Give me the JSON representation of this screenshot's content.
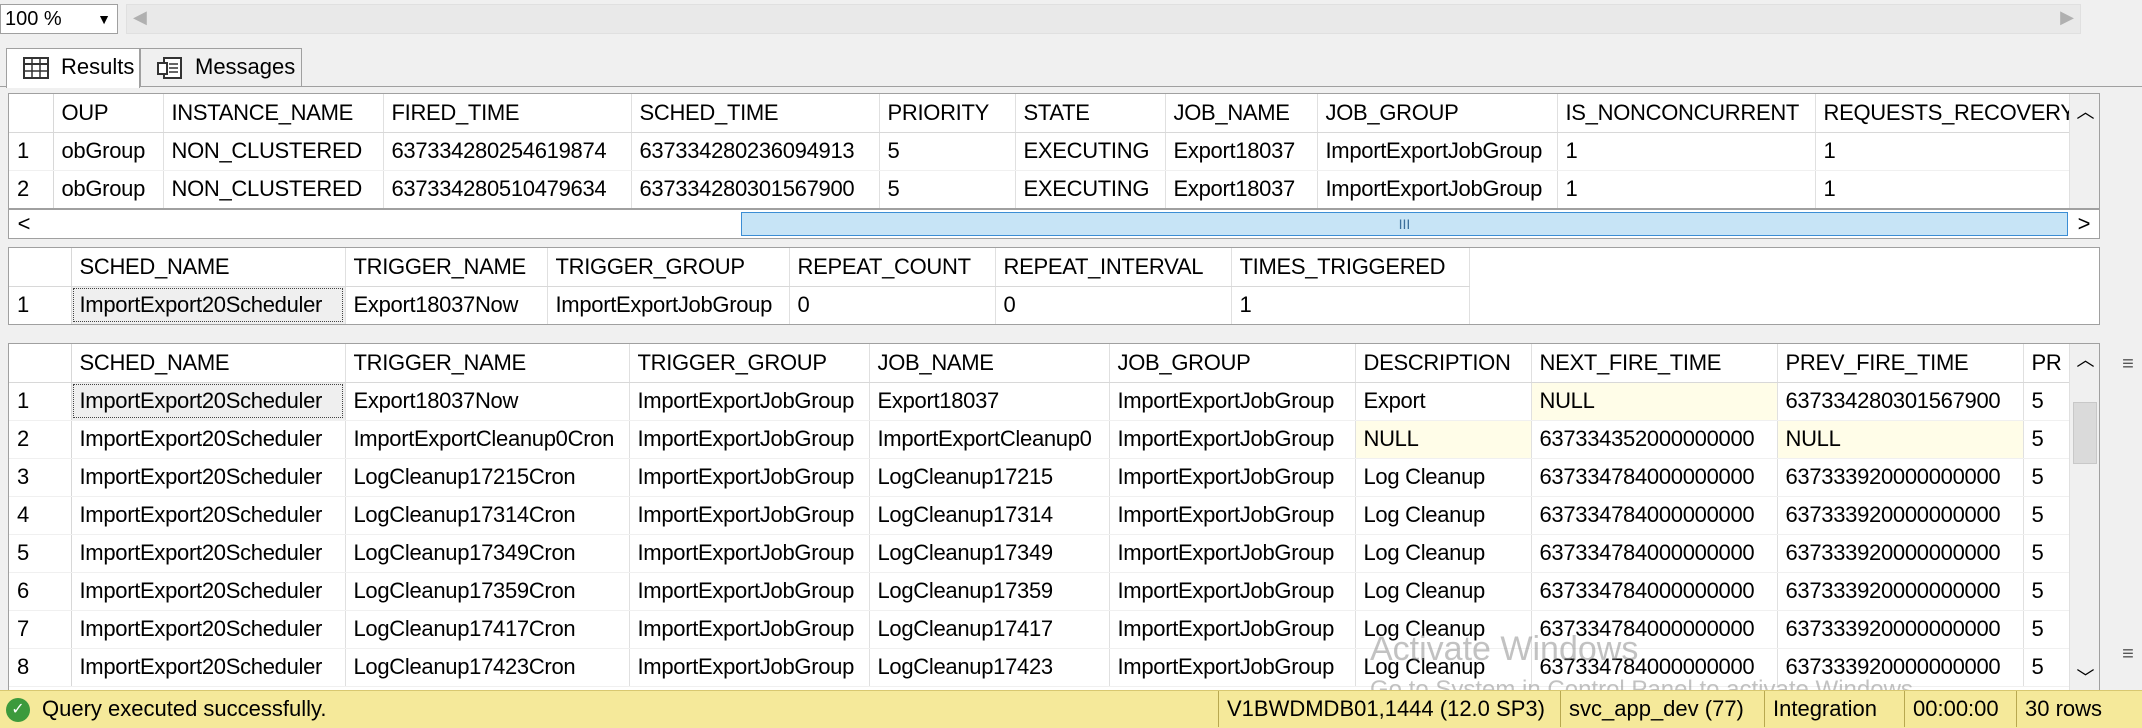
{
  "zoom": {
    "value": "100 %"
  },
  "tabs": [
    {
      "label": "Results",
      "icon": "grid-icon",
      "active": true
    },
    {
      "label": "Messages",
      "icon": "messages-icon",
      "active": false
    }
  ],
  "grid1": {
    "headers": [
      "",
      "OUP",
      "INSTANCE_NAME",
      "FIRED_TIME",
      "SCHED_TIME",
      "PRIORITY",
      "STATE",
      "JOB_NAME",
      "JOB_GROUP",
      "IS_NONCONCURRENT",
      "REQUESTS_RECOVERY"
    ],
    "rows": [
      [
        "1",
        "obGroup",
        "NON_CLUSTERED",
        "637334280254619874",
        "637334280236094913",
        "5",
        "EXECUTING",
        "Export18037",
        "ImportExportJobGroup",
        "1",
        "1"
      ],
      [
        "2",
        "obGroup",
        "NON_CLUSTERED",
        "637334280510479634",
        "637334280301567900",
        "5",
        "EXECUTING",
        "Export18037",
        "ImportExportJobGroup",
        "1",
        "1"
      ]
    ]
  },
  "grid2": {
    "headers": [
      "",
      "SCHED_NAME",
      "TRIGGER_NAME",
      "TRIGGER_GROUP",
      "REPEAT_COUNT",
      "REPEAT_INTERVAL",
      "TIMES_TRIGGERED"
    ],
    "rows": [
      [
        "1",
        "ImportExport20Scheduler",
        "Export18037Now",
        "ImportExportJobGroup",
        "0",
        "0",
        "1"
      ]
    ]
  },
  "grid3": {
    "headers": [
      "",
      "SCHED_NAME",
      "TRIGGER_NAME",
      "TRIGGER_GROUP",
      "JOB_NAME",
      "JOB_GROUP",
      "DESCRIPTION",
      "NEXT_FIRE_TIME",
      "PREV_FIRE_TIME",
      "PR"
    ],
    "rows": [
      [
        "1",
        "ImportExport20Scheduler",
        "Export18037Now",
        "ImportExportJobGroup",
        "Export18037",
        "ImportExportJobGroup",
        "Export",
        "NULL",
        "637334280301567900",
        "5"
      ],
      [
        "2",
        "ImportExport20Scheduler",
        "ImportExportCleanup0Cron",
        "ImportExportJobGroup",
        "ImportExportCleanup0",
        "ImportExportJobGroup",
        "NULL",
        "637334352000000000",
        "NULL",
        "5"
      ],
      [
        "3",
        "ImportExport20Scheduler",
        "LogCleanup17215Cron",
        "ImportExportJobGroup",
        "LogCleanup17215",
        "ImportExportJobGroup",
        "Log Cleanup",
        "637334784000000000",
        "637333920000000000",
        "5"
      ],
      [
        "4",
        "ImportExport20Scheduler",
        "LogCleanup17314Cron",
        "ImportExportJobGroup",
        "LogCleanup17314",
        "ImportExportJobGroup",
        "Log Cleanup",
        "637334784000000000",
        "637333920000000000",
        "5"
      ],
      [
        "5",
        "ImportExport20Scheduler",
        "LogCleanup17349Cron",
        "ImportExportJobGroup",
        "LogCleanup17349",
        "ImportExportJobGroup",
        "Log Cleanup",
        "637334784000000000",
        "637333920000000000",
        "5"
      ],
      [
        "6",
        "ImportExport20Scheduler",
        "LogCleanup17359Cron",
        "ImportExportJobGroup",
        "LogCleanup17359",
        "ImportExportJobGroup",
        "Log Cleanup",
        "637334784000000000",
        "637333920000000000",
        "5"
      ],
      [
        "7",
        "ImportExport20Scheduler",
        "LogCleanup17417Cron",
        "ImportExportJobGroup",
        "LogCleanup17417",
        "ImportExportJobGroup",
        "Log Cleanup",
        "637334784000000000",
        "637333920000000000",
        "5"
      ],
      [
        "8",
        "ImportExport20Scheduler",
        "LogCleanup17423Cron",
        "ImportExportJobGroup",
        "LogCleanup17423",
        "ImportExportJobGroup",
        "Log Cleanup",
        "637334784000000000",
        "637333920000000000",
        "5"
      ]
    ]
  },
  "watermark": {
    "line1": "Activate Windows",
    "line2": "Go to System in Control Panel to activate Windows."
  },
  "status": {
    "message": "Query executed successfully.",
    "server": "V1BWDMDB01,1444 (12.0 SP3)",
    "user": "svc_app_dev (77)",
    "database": "Integration",
    "elapsed": "00:00:00",
    "rows": "30 rows",
    "color": "#f5e99a"
  }
}
